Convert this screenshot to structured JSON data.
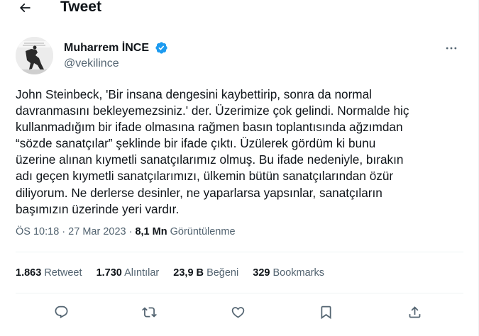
{
  "header": {
    "title": "Tweet",
    "back_icon": "arrow-left-icon"
  },
  "author": {
    "name": "Muharrem İNCE",
    "handle": "@vekilince",
    "verified": true,
    "verified_color": "#1d9bf0"
  },
  "tweet": {
    "lines": [
      "John Steinbeck, 'Bir insana dengesini kaybettirip, sonra da normal",
      "davranmasını bekleyemezsiniz.' der. Üzerimize çok gelindi. Normalde hiç",
      "kullanmadığım bir ifade olmasına rağmen basın toplantısında ağzımdan",
      "“sözde sanatçılar” şeklinde bir ifade çıktı. Üzülerek gördüm ki bunu",
      "üzerine alınan kıymetli sanatçılarımız olmuş. Bu ifade nedeniyle, bırakın",
      "adı geçen kıymetli sanatçılarımızı, ülkemin bütün sanatçılarından özür",
      "diliyorum. Ne derlerse desinler, ne yaparlarsa yapsınlar, sanatçıların",
      "başımızın üzerinde yeri vardır."
    ]
  },
  "meta": {
    "time": "ÖS 10:18",
    "sep1": " · ",
    "date": "27 Mar 2023",
    "sep2": " · ",
    "views_count": "8,1 Mn",
    "views_label": "Görüntülenme"
  },
  "stats": [
    {
      "count": "1.863",
      "label": "Retweet"
    },
    {
      "count": "1.730",
      "label": "Alıntılar"
    },
    {
      "count": "23,9 B",
      "label": "Beğeni"
    },
    {
      "count": "329",
      "label": "Bookmarks"
    }
  ],
  "actions": [
    "reply-icon",
    "retweet-icon",
    "like-icon",
    "bookmark-icon",
    "share-icon"
  ],
  "colors": {
    "text_primary": "#0f1419",
    "text_secondary": "#536471",
    "divider": "#eff3f4",
    "accent": "#1d9bf0"
  }
}
